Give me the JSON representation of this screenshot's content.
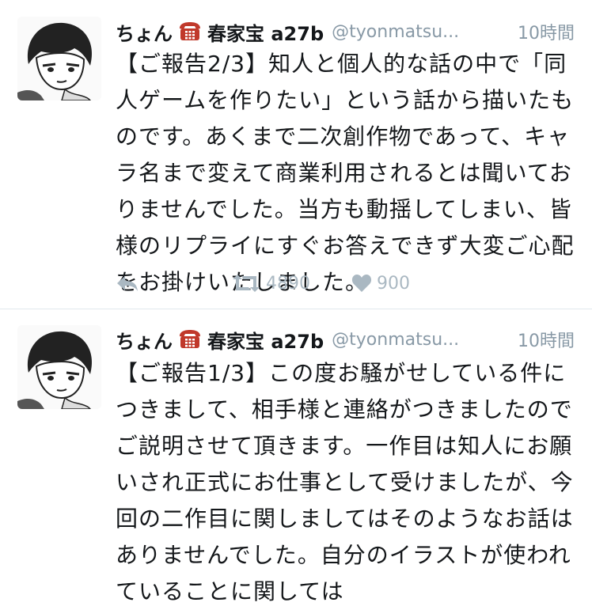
{
  "tweets": [
    {
      "display_name": "ちょん",
      "name_suffix": "春家宝 a27b",
      "handle": "@tyonmatsu...",
      "time": "10時間",
      "text": "【ご報告2/3】知人と個人的な話の中で「同人ゲームを作りたい」という話から描いたものです。あくまで二次創作物であって、キャラ名まで変えて商業利用されるとは聞いておりませんでした。当方も動揺してしまい、皆様のリプライにすぐお答えできず大変ご心配をお掛けいたしました。",
      "retweets": "4890",
      "likes": "900"
    },
    {
      "display_name": "ちょん",
      "name_suffix": "春家宝 a27b",
      "handle": "@tyonmatsu...",
      "time": "10時間",
      "text": "【ご報告1/3】この度お騒がせしている件につきまして、相手様と連絡がつきましたのでご説明させて頂きます。一作目は知人にお願いされ正式にお仕事として受けましたが、今回の二作目に関しましてはそのようなお話はありませんでした。自分のイラストが使われていることに関しては"
    }
  ],
  "icons": {
    "phone": "telephone-icon",
    "reply": "reply-icon",
    "retweet": "retweet-icon",
    "like": "heart-icon"
  },
  "colors": {
    "secondary_text": "#8899a6",
    "action_icon": "#aab8c2",
    "phone_red": "#c0392b"
  }
}
